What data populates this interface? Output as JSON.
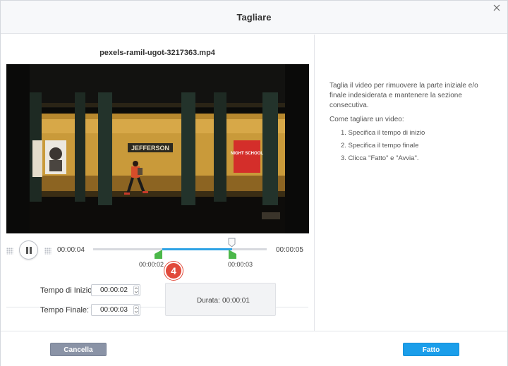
{
  "dialog": {
    "title": "Tagliare"
  },
  "player": {
    "filename": "pexels-ramil-ugot-3217363.mp4",
    "current_time": "00:00:04",
    "total_time": "00:00:05",
    "start_marker_time": "00:00:02",
    "end_marker_time": "00:00:03",
    "step_badge": "4",
    "video_sign_text": "JEFFERSON",
    "poster_text": "NIGHT SCHOOL"
  },
  "trim_form": {
    "start_label": "Tempo di Inizio:",
    "start_value": "00:00:02",
    "end_label": "Tempo Finale:",
    "end_value": "00:00:03",
    "duration_label": "Durata:",
    "duration_value": "00:00:01"
  },
  "instructions": {
    "description": "Taglia il video per rimuovere la parte iniziale e/o finale indesiderata e mantenere la sezione consecutiva.",
    "how_to_title": "Come tagliare un video:",
    "steps": [
      "1. Specifica il tempo di inizio",
      "2. Specifica il tempo finale",
      "3. Clicca \"Fatto\" e \"Avvia\"."
    ]
  },
  "footer": {
    "cancel_label": "Cancella",
    "done_label": "Fatto"
  },
  "colors": {
    "accent": "#1b9eea",
    "selection": "#2fa3e5",
    "marker": "#4cb84a",
    "badge": "#e14a3b",
    "cancel_button": "#8a93a6"
  }
}
